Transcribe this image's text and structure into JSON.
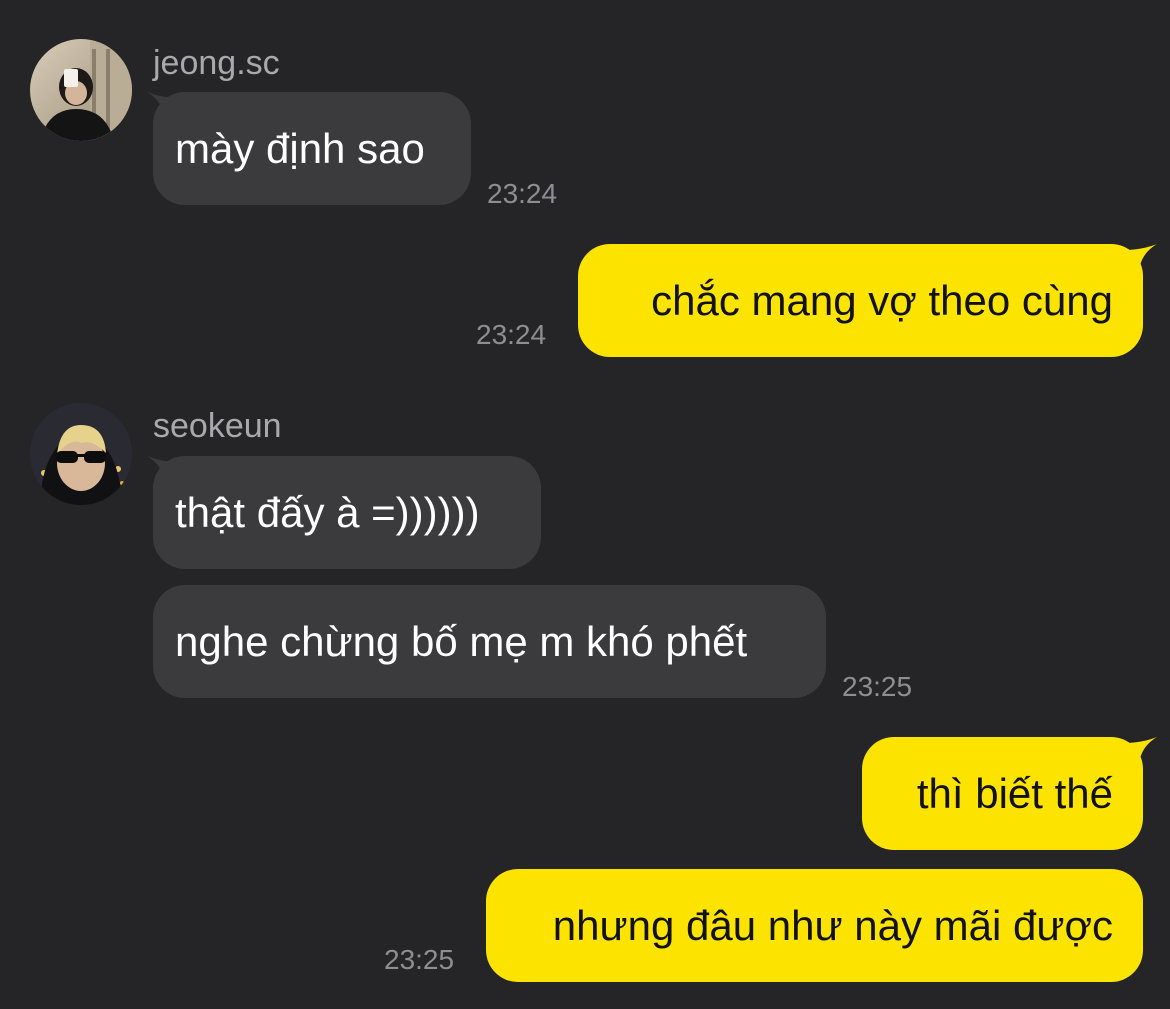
{
  "colors": {
    "background": "#252527",
    "incoming_bubble": "#3b3b3e",
    "outgoing_bubble": "#fde400",
    "timestamp": "#8e8e92",
    "sender_name": "#a9a9ad"
  },
  "messages": {
    "group1": {
      "sender": "jeong.sc",
      "avatar_icon": "avatar-photo-icon",
      "bubble1": "mày định sao",
      "time": "23:24"
    },
    "out1": {
      "bubble1": "chắc mang vợ theo cùng",
      "time": "23:24"
    },
    "group2": {
      "sender": "seokeun",
      "avatar_icon": "avatar-photo-icon",
      "bubble1": "thật đấy à =))))))",
      "bubble2": "nghe chừng bố mẹ m khó phết",
      "time": "23:25"
    },
    "out2": {
      "bubble1": "thì biết thế",
      "bubble2": "nhưng đâu như này mãi được",
      "time": "23:25"
    }
  }
}
